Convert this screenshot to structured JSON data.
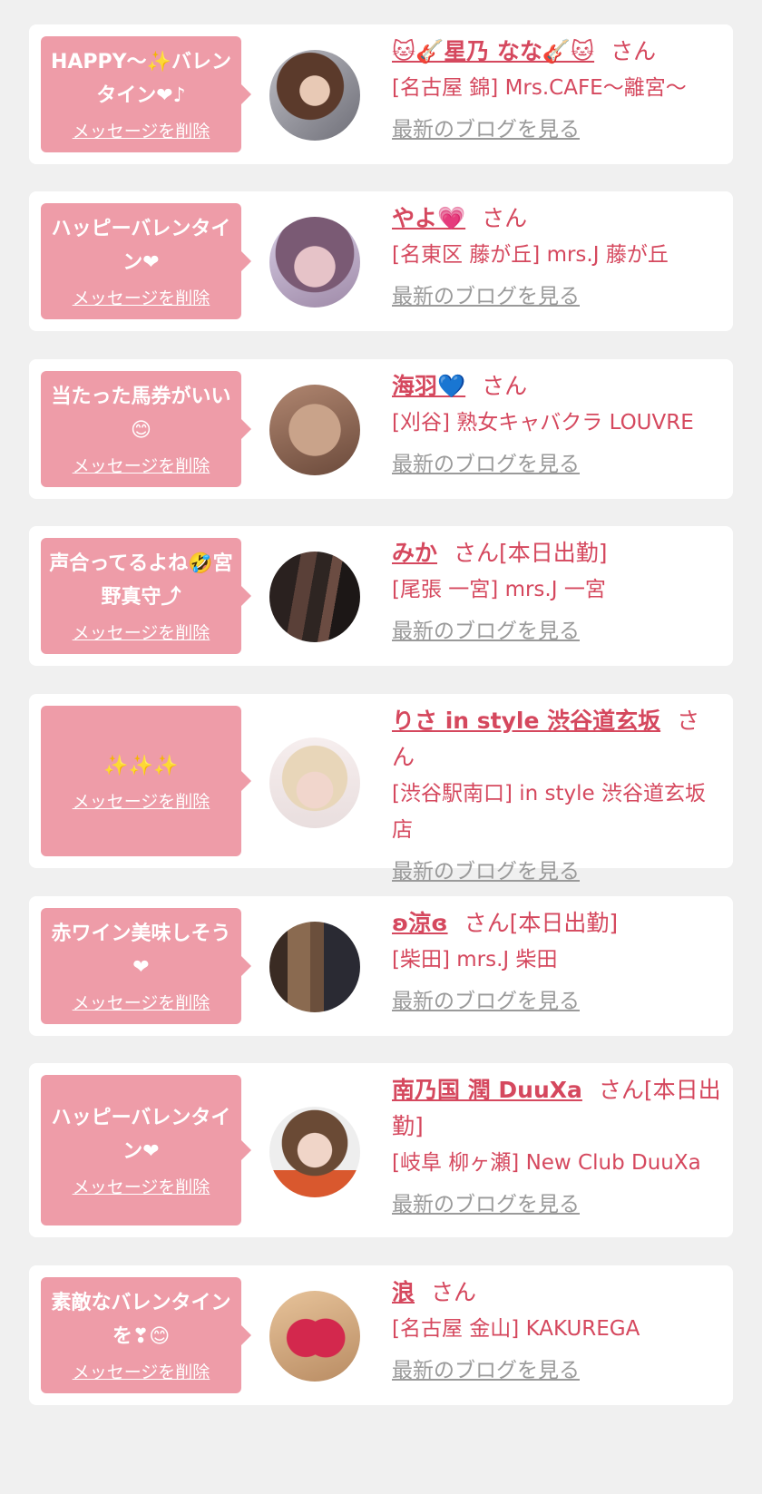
{
  "colors": {
    "background": "#f0f0f0",
    "card": "#ffffff",
    "bubble": "#ee9ca8",
    "accent_text": "#d5485e",
    "link_gray": "#9a9a9a"
  },
  "cards": [
    {
      "message": "HAPPY～✨バレンタイン❤♪",
      "delete_label": "メッセージを削除",
      "cast_name": "🐱🎸星乃 なな🎸🐱",
      "honorific": "さん",
      "shop": "[名古屋 錦] Mrs.CAFE～離宮～",
      "blog_label": "最新のブログを見る",
      "avatar_icon": "woman-portrait-photo"
    },
    {
      "message": "ハッピーバレンタイン❤",
      "delete_label": "メッセージを削除",
      "cast_name": "やよ💗",
      "honorific": "さん",
      "shop": "[名東区 藤が丘] mrs.J 藤が丘",
      "blog_label": "最新のブログを見る",
      "avatar_icon": "woman-winking-photo"
    },
    {
      "message": "当たった馬券がいい😊",
      "delete_label": "メッセージを削除",
      "cast_name": "海羽💙",
      "honorific": "さん",
      "shop": "[刈谷] 熟女キャバクラ LOUVRE",
      "blog_label": "最新のブログを見る",
      "avatar_icon": "hair-closeup-photo"
    },
    {
      "message": "声合ってるよね🤣宮野真守⤴",
      "delete_label": "メッセージを削除",
      "cast_name": "みか",
      "honorific": "さん[本日出勤]",
      "shop": "[尾張 一宮] mrs.J 一宮",
      "blog_label": "最新のブログを見る",
      "avatar_icon": "legs-stockings-photo"
    },
    {
      "message": "✨✨✨",
      "delete_label": "メッセージを削除",
      "cast_name": "りさ in style 渋谷道玄坂",
      "honorific": "さん",
      "shop": "[渋谷駅南口] in style 渋谷道玄坂店",
      "blog_label": "最新のブログを見る",
      "avatar_icon": "blonde-woman-photo"
    },
    {
      "message": "赤ワイン美味しそう❤",
      "delete_label": "メッセージを削除",
      "cast_name": "ʚ涼ɞ",
      "honorific": "さん[本日出勤]",
      "shop": "[柴田] mrs.J 柴田",
      "blog_label": "最新のブログを見る",
      "avatar_icon": "long-hair-back-photo"
    },
    {
      "message": "ハッピーバレンタイン❤",
      "delete_label": "メッセージを削除",
      "cast_name": "南乃国 潤 DuuXa",
      "honorific": "さん[本日出勤]",
      "shop": "[岐阜 柳ヶ瀬] New Club DuuXa",
      "blog_label": "最新のブログを見る",
      "avatar_icon": "woman-smiling-photo"
    },
    {
      "message": "素敵なバレンタインを❣😊",
      "delete_label": "メッセージを削除",
      "cast_name": "浪",
      "honorific": "さん",
      "shop": "[名古屋 金山] KAKUREGA",
      "blog_label": "最新のブログを見る",
      "avatar_icon": "glitter-heart-photo"
    }
  ]
}
